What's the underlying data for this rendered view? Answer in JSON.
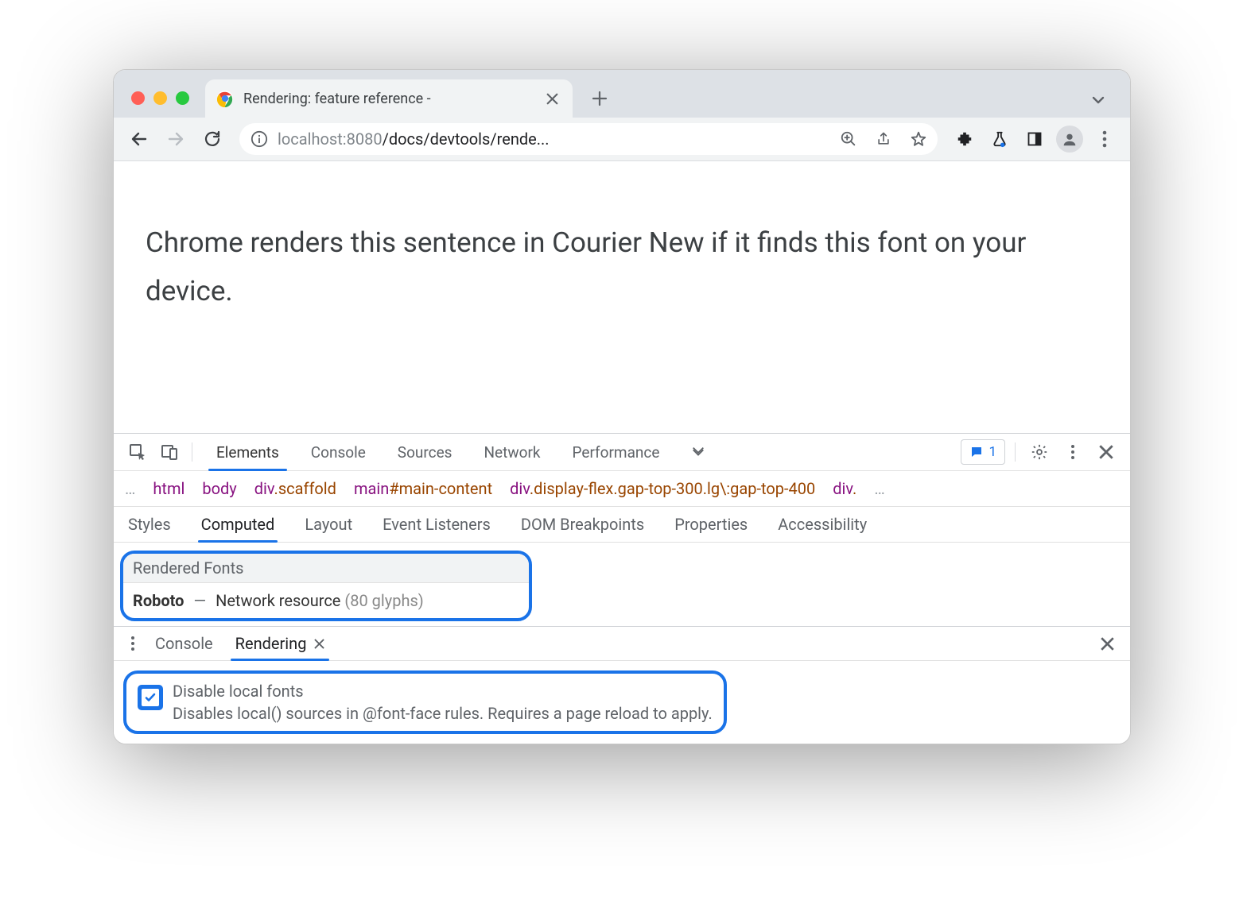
{
  "browser": {
    "tab_title": "Rendering: feature reference -",
    "url_host_muted": "localhost",
    "url_port_muted": ":8080",
    "url_path": "/docs/devtools/rende..."
  },
  "page": {
    "text": "Chrome renders this sentence in Courier New if it finds this font on your device."
  },
  "devtools": {
    "tabs": [
      "Elements",
      "Console",
      "Sources",
      "Network",
      "Performance"
    ],
    "issues_count": "1",
    "breadcrumb": [
      {
        "tag": "html"
      },
      {
        "tag": "body"
      },
      {
        "tag": "div",
        "cls": ".scaffold"
      },
      {
        "tag": "main",
        "id": "#main-content"
      },
      {
        "tag": "div",
        "cls": ".display-flex.gap-top-300.lg\\:gap-top-400"
      },
      {
        "tag": "div",
        "cls": "."
      }
    ],
    "subtabs": [
      "Styles",
      "Computed",
      "Layout",
      "Event Listeners",
      "DOM Breakpoints",
      "Properties",
      "Accessibility"
    ],
    "rendered_fonts": {
      "title": "Rendered Fonts",
      "font_name": "Roboto",
      "source": "Network resource",
      "glyphs": "(80 glyphs)"
    },
    "drawer": {
      "tabs": [
        "Console",
        "Rendering"
      ],
      "option_title": "Disable local fonts",
      "option_desc": "Disables local() sources in @font-face rules. Requires a page reload to apply."
    }
  }
}
